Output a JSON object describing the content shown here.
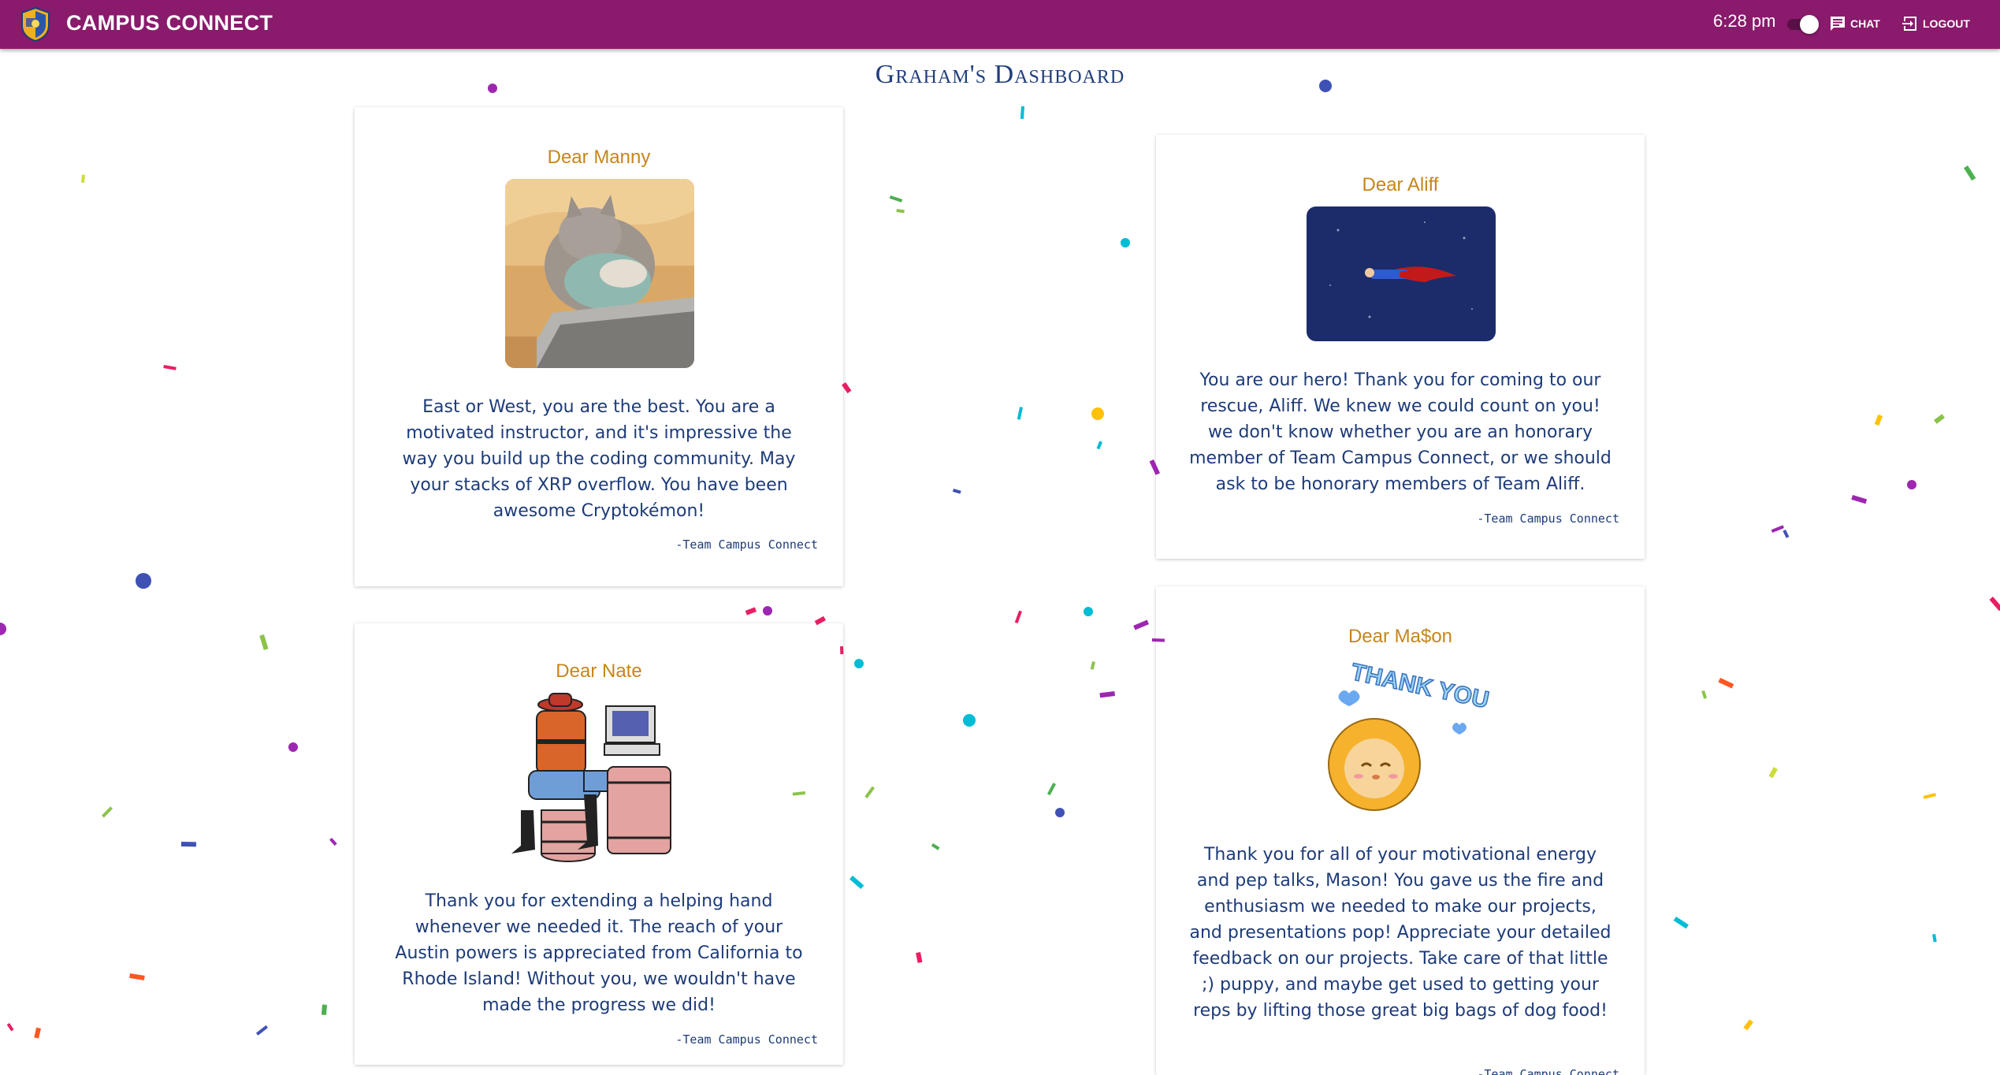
{
  "app": {
    "name": "CAMPUS CONNECT"
  },
  "header": {
    "time": "6:28 pm",
    "chat_label": "CHAT",
    "logout_label": "LOGOUT",
    "theme_toggle_on": true
  },
  "page": {
    "title": "Graham's Dashboard"
  },
  "cards": [
    {
      "title": "Dear Manny",
      "image": "cat-typing-gif",
      "message": "East or West, you are the best. You are a motivated instructor, and it's impressive the way you build up the coding community. May your stacks of XRP overflow. You have been awesome Cryptokémon!",
      "signature": "-Team Campus Connect"
    },
    {
      "title": "Dear Aliff",
      "image": "superman-flying-gif",
      "message": "You are our hero! Thank you for coming to our rescue, Aliff. We knew we could count on you! we don't know whether you are an honorary member of Team Campus Connect, or we should ask to be honorary members of Team Aliff.",
      "signature": "-Team Campus Connect"
    },
    {
      "title": "Dear Nate",
      "image": "cowboy-at-computer-illustration",
      "message": "Thank you for extending a helping hand whenever we needed it. The reach of your Austin powers is appreciated from California to Rhode Island! Without you, we wouldn't have made the progress we did!",
      "signature": "-Team Campus Connect"
    },
    {
      "title": "Dear Ma$on",
      "image": "thank-you-lion-sticker",
      "sticker_text": "THANK YOU",
      "message": "Thank you for all of your motivational energy and pep talks, Mason! You gave us the fire and enthusiasm we needed to make our projects, and presentations pop! Appreciate your detailed feedback on our projects. Take care of that little ;) puppy, and maybe get used to getting your reps by lifting those great big bags of dog food!",
      "signature": "-Team Campus Connect"
    }
  ],
  "colors": {
    "topbar": "#8a1a6c",
    "title": "#1f3d7a",
    "card_title": "#c7851a",
    "card_text": "#1d3b78",
    "confetti": [
      "#3f51b5",
      "#00bcd4",
      "#8bc34a",
      "#ffc107",
      "#9c27b0",
      "#e91e63",
      "#ff5722",
      "#cddc39",
      "#4caf50"
    ]
  }
}
